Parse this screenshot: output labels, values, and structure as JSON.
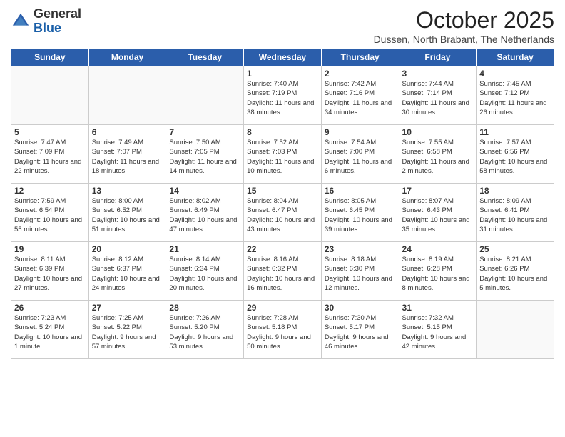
{
  "logo": {
    "general": "General",
    "blue": "Blue"
  },
  "header": {
    "month": "October 2025",
    "location": "Dussen, North Brabant, The Netherlands"
  },
  "days_of_week": [
    "Sunday",
    "Monday",
    "Tuesday",
    "Wednesday",
    "Thursday",
    "Friday",
    "Saturday"
  ],
  "weeks": [
    [
      {
        "day": "",
        "info": ""
      },
      {
        "day": "",
        "info": ""
      },
      {
        "day": "",
        "info": ""
      },
      {
        "day": "1",
        "info": "Sunrise: 7:40 AM\nSunset: 7:19 PM\nDaylight: 11 hours\nand 38 minutes."
      },
      {
        "day": "2",
        "info": "Sunrise: 7:42 AM\nSunset: 7:16 PM\nDaylight: 11 hours\nand 34 minutes."
      },
      {
        "day": "3",
        "info": "Sunrise: 7:44 AM\nSunset: 7:14 PM\nDaylight: 11 hours\nand 30 minutes."
      },
      {
        "day": "4",
        "info": "Sunrise: 7:45 AM\nSunset: 7:12 PM\nDaylight: 11 hours\nand 26 minutes."
      }
    ],
    [
      {
        "day": "5",
        "info": "Sunrise: 7:47 AM\nSunset: 7:09 PM\nDaylight: 11 hours\nand 22 minutes."
      },
      {
        "day": "6",
        "info": "Sunrise: 7:49 AM\nSunset: 7:07 PM\nDaylight: 11 hours\nand 18 minutes."
      },
      {
        "day": "7",
        "info": "Sunrise: 7:50 AM\nSunset: 7:05 PM\nDaylight: 11 hours\nand 14 minutes."
      },
      {
        "day": "8",
        "info": "Sunrise: 7:52 AM\nSunset: 7:03 PM\nDaylight: 11 hours\nand 10 minutes."
      },
      {
        "day": "9",
        "info": "Sunrise: 7:54 AM\nSunset: 7:00 PM\nDaylight: 11 hours\nand 6 minutes."
      },
      {
        "day": "10",
        "info": "Sunrise: 7:55 AM\nSunset: 6:58 PM\nDaylight: 11 hours\nand 2 minutes."
      },
      {
        "day": "11",
        "info": "Sunrise: 7:57 AM\nSunset: 6:56 PM\nDaylight: 10 hours\nand 58 minutes."
      }
    ],
    [
      {
        "day": "12",
        "info": "Sunrise: 7:59 AM\nSunset: 6:54 PM\nDaylight: 10 hours\nand 55 minutes."
      },
      {
        "day": "13",
        "info": "Sunrise: 8:00 AM\nSunset: 6:52 PM\nDaylight: 10 hours\nand 51 minutes."
      },
      {
        "day": "14",
        "info": "Sunrise: 8:02 AM\nSunset: 6:49 PM\nDaylight: 10 hours\nand 47 minutes."
      },
      {
        "day": "15",
        "info": "Sunrise: 8:04 AM\nSunset: 6:47 PM\nDaylight: 10 hours\nand 43 minutes."
      },
      {
        "day": "16",
        "info": "Sunrise: 8:05 AM\nSunset: 6:45 PM\nDaylight: 10 hours\nand 39 minutes."
      },
      {
        "day": "17",
        "info": "Sunrise: 8:07 AM\nSunset: 6:43 PM\nDaylight: 10 hours\nand 35 minutes."
      },
      {
        "day": "18",
        "info": "Sunrise: 8:09 AM\nSunset: 6:41 PM\nDaylight: 10 hours\nand 31 minutes."
      }
    ],
    [
      {
        "day": "19",
        "info": "Sunrise: 8:11 AM\nSunset: 6:39 PM\nDaylight: 10 hours\nand 27 minutes."
      },
      {
        "day": "20",
        "info": "Sunrise: 8:12 AM\nSunset: 6:37 PM\nDaylight: 10 hours\nand 24 minutes."
      },
      {
        "day": "21",
        "info": "Sunrise: 8:14 AM\nSunset: 6:34 PM\nDaylight: 10 hours\nand 20 minutes."
      },
      {
        "day": "22",
        "info": "Sunrise: 8:16 AM\nSunset: 6:32 PM\nDaylight: 10 hours\nand 16 minutes."
      },
      {
        "day": "23",
        "info": "Sunrise: 8:18 AM\nSunset: 6:30 PM\nDaylight: 10 hours\nand 12 minutes."
      },
      {
        "day": "24",
        "info": "Sunrise: 8:19 AM\nSunset: 6:28 PM\nDaylight: 10 hours\nand 8 minutes."
      },
      {
        "day": "25",
        "info": "Sunrise: 8:21 AM\nSunset: 6:26 PM\nDaylight: 10 hours\nand 5 minutes."
      }
    ],
    [
      {
        "day": "26",
        "info": "Sunrise: 7:23 AM\nSunset: 5:24 PM\nDaylight: 10 hours\nand 1 minute."
      },
      {
        "day": "27",
        "info": "Sunrise: 7:25 AM\nSunset: 5:22 PM\nDaylight: 9 hours\nand 57 minutes."
      },
      {
        "day": "28",
        "info": "Sunrise: 7:26 AM\nSunset: 5:20 PM\nDaylight: 9 hours\nand 53 minutes."
      },
      {
        "day": "29",
        "info": "Sunrise: 7:28 AM\nSunset: 5:18 PM\nDaylight: 9 hours\nand 50 minutes."
      },
      {
        "day": "30",
        "info": "Sunrise: 7:30 AM\nSunset: 5:17 PM\nDaylight: 9 hours\nand 46 minutes."
      },
      {
        "day": "31",
        "info": "Sunrise: 7:32 AM\nSunset: 5:15 PM\nDaylight: 9 hours\nand 42 minutes."
      },
      {
        "day": "",
        "info": ""
      }
    ]
  ]
}
